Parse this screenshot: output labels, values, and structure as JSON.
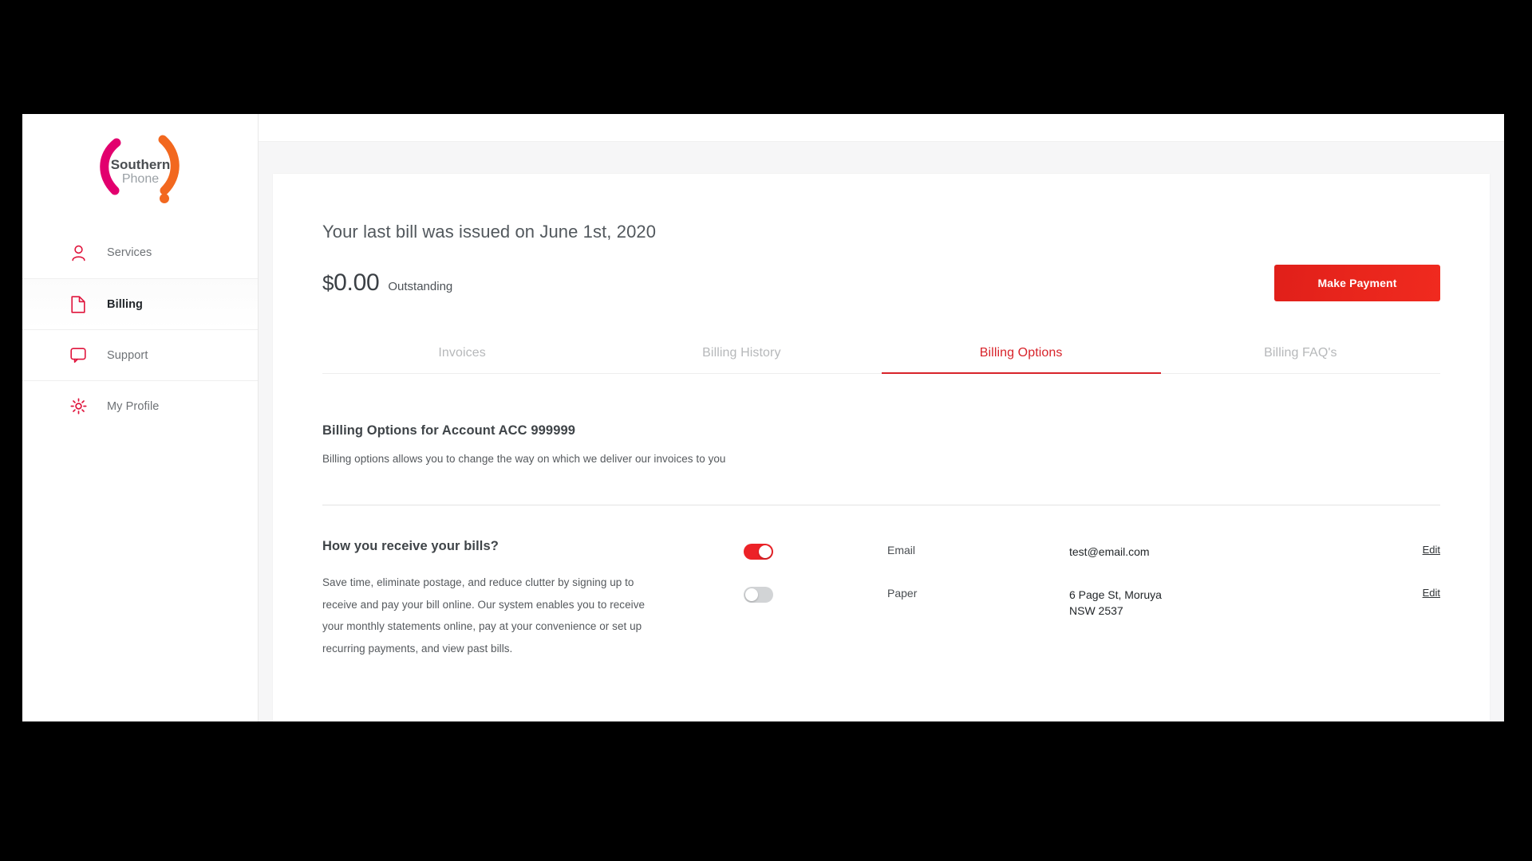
{
  "brand": {
    "logo_name": "southern-phone-logo",
    "logo_line1": "Southern",
    "logo_line2": "Phone",
    "magenta": "#e2006e",
    "orange": "#f2681f",
    "red": "#d8232a"
  },
  "sidebar": {
    "items": [
      {
        "label": "Services",
        "icon": "user-icon",
        "active": false
      },
      {
        "label": "Billing",
        "icon": "document-icon",
        "active": true
      },
      {
        "label": "Support",
        "icon": "chat-icon",
        "active": false
      },
      {
        "label": "My Profile",
        "icon": "gear-icon",
        "active": false
      }
    ]
  },
  "bill_summary": {
    "headline": "Your last bill was issued on June 1st, 2020",
    "currency_symbol": "$",
    "amount": "0.00",
    "amount_label": "Outstanding",
    "pay_button": "Make Payment"
  },
  "tabs": [
    {
      "label": "Invoices",
      "active": false
    },
    {
      "label": "Billing History",
      "active": false
    },
    {
      "label": "Billing Options",
      "active": true
    },
    {
      "label": "Billing FAQ's",
      "active": false
    }
  ],
  "billing_options": {
    "title_prefix": "Billing Options for Account ACC ",
    "account_number": "999999",
    "description": "Billing options allows you to change the way on which we deliver our invoices to you"
  },
  "delivery": {
    "title": "How you receive your bills?",
    "body": "Save time, eliminate postage, and reduce clutter by signing up to receive and pay your bill online. Our system enables you to receive your monthly statements online, pay at your convenience or set up recurring payments, and view past bills.",
    "edit_label": "Edit",
    "options": [
      {
        "name": "Email",
        "value": "test@email.com",
        "enabled": true,
        "edit": "Edit"
      },
      {
        "name": "Paper",
        "value": "6 Page St, Moruya\nNSW 2537",
        "enabled": false,
        "edit": "Edit"
      }
    ]
  }
}
